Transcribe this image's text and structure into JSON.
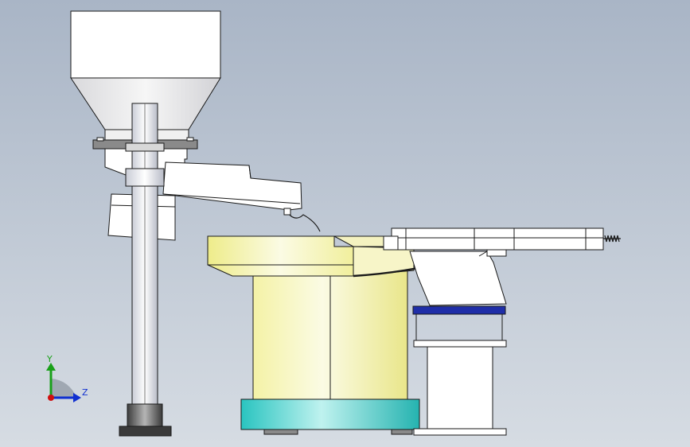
{
  "viewport": {
    "background_top": "#a9b5c6",
    "background_bottom": "#d6dce3"
  },
  "model": {
    "outline_color": "#1a1a1a",
    "part_white": "#ffffff",
    "hopper_gray": "#e8e8e8",
    "bowl_yellow": "#f4f2a6",
    "bowl_yellow_light": "#fbfbe4",
    "base_cyan": "#29c4c0",
    "base_cyan_light": "#bff2ef",
    "bracket_blue": "#1f2ea8",
    "pillar_dark": "#6f6f6f"
  },
  "triad": {
    "y_label": "Y",
    "z_label": "Z",
    "y_color": "#19a019",
    "z_color": "#1030d0",
    "origin_color": "#d01010"
  }
}
